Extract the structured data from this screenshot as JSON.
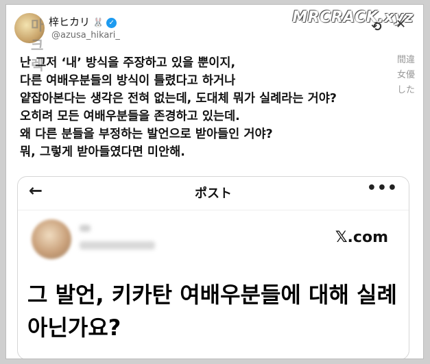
{
  "header": {
    "display_name": "梓ヒカリ",
    "rabbit_emoji": "🐰",
    "verified_symbol": "✓",
    "handle": "@azusa_hikari_",
    "avatar_overlay_text": "마크렉"
  },
  "watermark": "MRCRACK.xyz",
  "top_icons": [
    "link-icon",
    "more-icon"
  ],
  "side_text": [
    "間違",
    "女優",
    "した"
  ],
  "body_lines": [
    "난 그저 ‘내’ 방식을 주장하고 있을 뿐이지,",
    "다른 여배우분들의 방식이 틀렸다고 하거나",
    "얕잡아본다는 생각은 전혀 없는데, 도대체 뭐가 실례라는 거야?",
    "오히려 모든 여배우분들을 존경하고 있는데.",
    "왜 다른 분들을 부정하는 발언으로 받아들인 거야?",
    "뭐, 그렇게 받아들였다면 미안해."
  ],
  "embedded_card": {
    "title": "ポスト",
    "back_symbol": "←",
    "more_symbol": "•••",
    "source": "𝕏.com",
    "lines": [
      "그 발언, 키카탄 여배우분들에 대해 실례",
      "아닌가요?"
    ]
  },
  "colors": {
    "verified": "#1d9bf0",
    "page_background": "#cfcfcf"
  }
}
